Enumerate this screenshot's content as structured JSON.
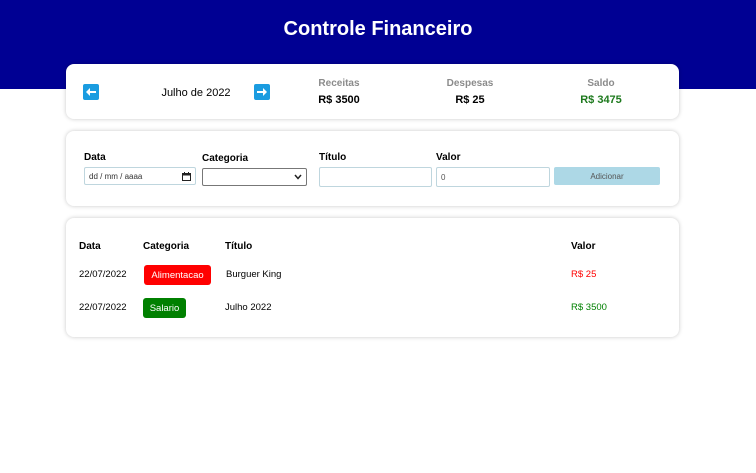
{
  "header": {
    "title": "Controle Financeiro"
  },
  "info": {
    "month_label": "Julho de 2022",
    "prev_icon": "arrow-left-icon",
    "next_icon": "arrow-right-icon",
    "receitas": {
      "label": "Receitas",
      "value": "R$ 3500"
    },
    "despesas": {
      "label": "Despesas",
      "value": "R$ 25"
    },
    "saldo": {
      "label": "Saldo",
      "value": "R$ 3475",
      "color": "#1e7a1e"
    }
  },
  "form": {
    "date": {
      "label": "Data",
      "placeholder": "dd / mm / aaaa",
      "icon": "calendar-icon"
    },
    "category": {
      "label": "Categoria",
      "value": "",
      "icon": "chevron-down-icon"
    },
    "title": {
      "label": "Título",
      "value": ""
    },
    "value": {
      "label": "Valor",
      "value": "0"
    },
    "add_button": "Adicionar"
  },
  "table": {
    "headers": {
      "date": "Data",
      "category": "Categoria",
      "title": "Título",
      "value": "Valor"
    },
    "rows": [
      {
        "date": "22/07/2022",
        "category": "Alimentacao",
        "category_color": "#ff0000",
        "title": "Burguer King",
        "value": "R$ 25",
        "value_color": "#ff0000"
      },
      {
        "date": "22/07/2022",
        "category": "Salario",
        "category_color": "#008000",
        "title": "Julho 2022",
        "value": "R$ 3500",
        "value_color": "#008000"
      }
    ]
  }
}
